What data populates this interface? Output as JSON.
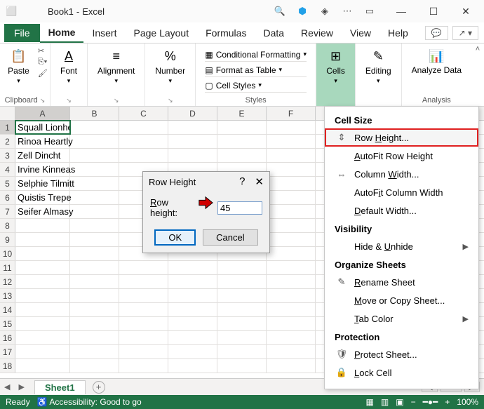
{
  "title": {
    "book": "Book1",
    "app": "Excel"
  },
  "tabs": [
    "File",
    "Home",
    "Insert",
    "Page Layout",
    "Formulas",
    "Data",
    "Review",
    "View",
    "Help"
  ],
  "active_tab": "Home",
  "ribbon": {
    "clipboard": {
      "label": "Clipboard",
      "paste": "Paste"
    },
    "font": "Font",
    "alignment": "Alignment",
    "number": "Number",
    "styles": {
      "label": "Styles",
      "cf": "Conditional Formatting",
      "fat": "Format as Table",
      "cs": "Cell Styles"
    },
    "cells": "Cells",
    "editing": "Editing",
    "analysis": {
      "label": "Analysis",
      "btn": "Analyze Data"
    }
  },
  "gridrows": [
    "Squall Lionheart",
    "Rinoa Heartly",
    "Zell Dincht",
    "Irvine Kinneas",
    "Selphie Tilmitt",
    "Quistis Trepe",
    "Seifer Almasy"
  ],
  "cols": [
    "A",
    "B",
    "C",
    "D",
    "E",
    "F"
  ],
  "sheet_tab": "Sheet1",
  "cells_menu": {
    "cellsize": "Cell Size",
    "rowheight": "Row Height...",
    "autofitrow": "AutoFit Row Height",
    "colwidth": "Column Width...",
    "autofitcol": "AutoFit Column Width",
    "defwidth": "Default Width...",
    "visibility": "Visibility",
    "hideunhide": "Hide & Unhide",
    "organize": "Organize Sheets",
    "rename": "Rename Sheet",
    "movecopy": "Move or Copy Sheet...",
    "tabcolor": "Tab Color",
    "protection": "Protection",
    "protectsheet": "Protect Sheet...",
    "lockcell": "Lock Cell"
  },
  "dialog": {
    "title": "Row Height",
    "label": "Row height:",
    "value": "45",
    "ok": "OK",
    "cancel": "Cancel"
  },
  "status": {
    "ready": "Ready",
    "acc": "Accessibility: Good to go",
    "zoom": "100%"
  }
}
